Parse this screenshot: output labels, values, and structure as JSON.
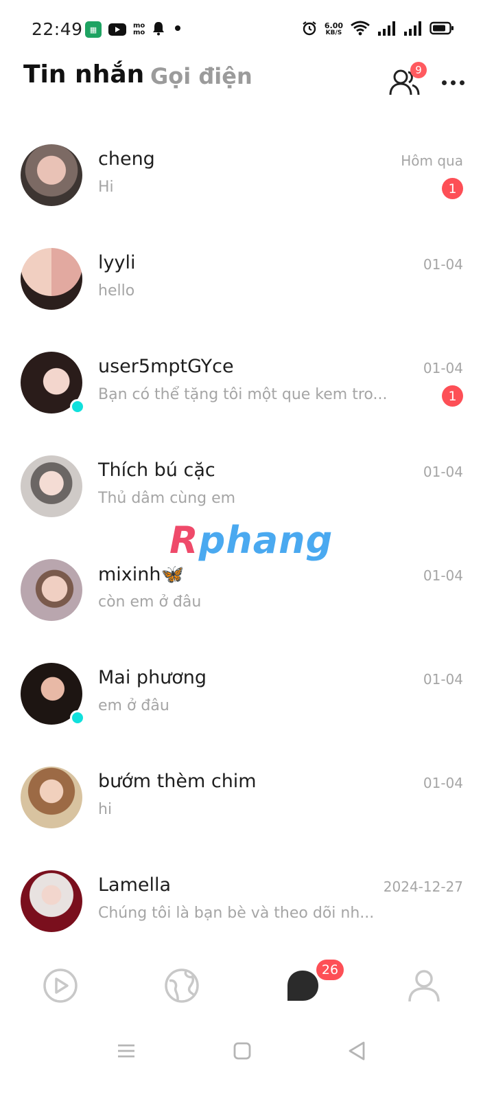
{
  "status_bar": {
    "time": "22:49",
    "network_speed_value": "6.00",
    "network_speed_unit": "KB/S",
    "left_icons": [
      "sheets-icon",
      "youtube-icon",
      "momo-icon",
      "bell-icon",
      "dot-icon"
    ],
    "right_icons": [
      "alarm-icon",
      "wifi-icon",
      "signal-icon",
      "signal-icon",
      "battery-icon"
    ]
  },
  "header": {
    "tab_messages": "Tin nhắn",
    "tab_calls": "Gọi điện",
    "friends_badge": "9"
  },
  "conversations": [
    {
      "name": "cheng",
      "preview": "Hi",
      "time": "Hôm qua",
      "unread": "1",
      "online": false
    },
    {
      "name": "lyyli",
      "preview": "hello",
      "time": "01-04",
      "unread": "",
      "online": false
    },
    {
      "name": "user5mptGYce",
      "preview": "Bạn có thể tặng tôi một que kem tro...",
      "time": "01-04",
      "unread": "1",
      "online": true
    },
    {
      "name": "Thích bú cặc",
      "preview": "Thủ dâm cùng em",
      "time": "01-04",
      "unread": "",
      "online": false
    },
    {
      "name": "mixinh🦋",
      "preview": "còn em ở đâu",
      "time": "01-04",
      "unread": "",
      "online": false
    },
    {
      "name": "Mai phương",
      "preview": "em ở đâu",
      "time": "01-04",
      "unread": "",
      "online": true
    },
    {
      "name": "bướm thèm chim",
      "preview": "hi",
      "time": "01-04",
      "unread": "",
      "online": false
    },
    {
      "name": "Lamella",
      "preview": "Chúng tôi là bạn bè và theo dõi nh...",
      "time": "2024-12-27",
      "unread": "",
      "online": false
    }
  ],
  "watermark": {
    "first": "R",
    "rest": "phang"
  },
  "bottom_nav": {
    "items": [
      "play-icon",
      "globe-icon",
      "chat-icon",
      "profile-icon"
    ],
    "chat_badge": "26"
  },
  "colors": {
    "badge": "#fd4f56",
    "online": "#10e0dc",
    "muted_text": "#a5a5a5",
    "inactive_tab": "#9b9b9b"
  }
}
